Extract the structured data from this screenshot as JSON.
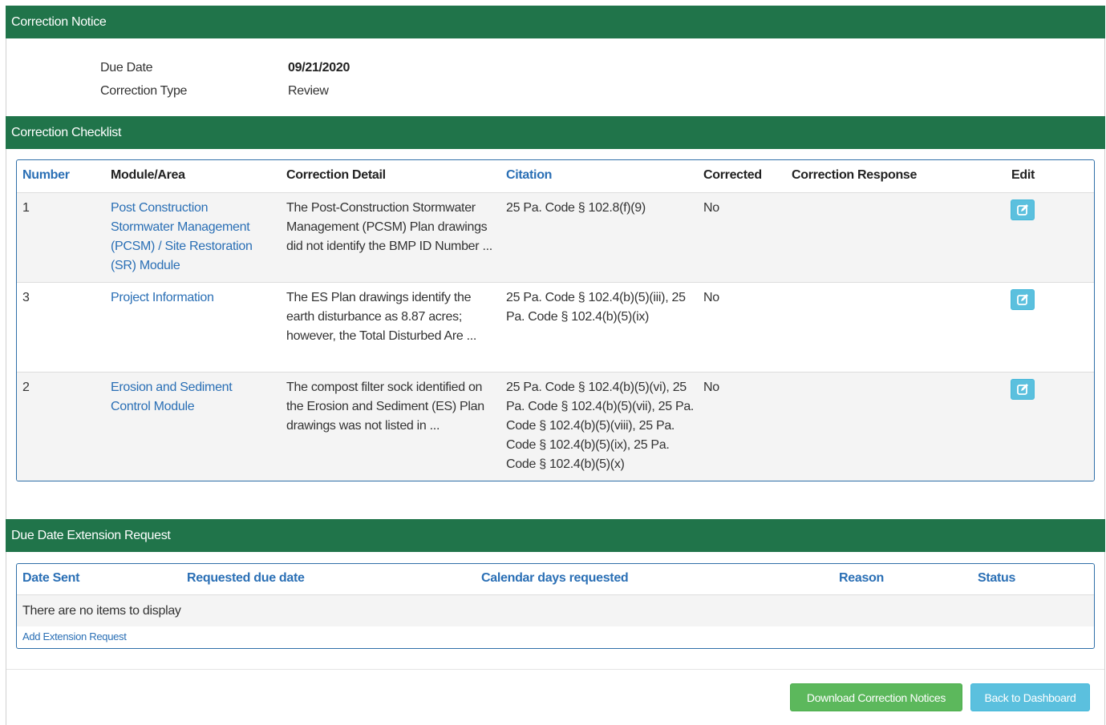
{
  "correction_notice": {
    "header": "Correction Notice",
    "due_date_label": "Due Date",
    "due_date_value": "09/21/2020",
    "correction_type_label": "Correction Type",
    "correction_type_value": "Review"
  },
  "checklist": {
    "header": "Correction Checklist",
    "columns": {
      "number": "Number",
      "module": "Module/Area",
      "detail": "Correction Detail",
      "citation": "Citation",
      "corrected": "Corrected",
      "response": "Correction Response",
      "edit": "Edit"
    },
    "rows": [
      {
        "number": "1",
        "module": "Post Construction Stormwater Management (PCSM) / Site Restoration (SR) Module",
        "detail": "The Post-Construction Stormwater Management (PCSM) Plan drawings did not identify the BMP ID Number ...",
        "citation": "25 Pa. Code § 102.8(f)(9)",
        "corrected": "No",
        "response": ""
      },
      {
        "number": "3",
        "module": "Project Information",
        "detail": "The ES Plan drawings identify the earth disturbance as 8.87 acres; however, the Total Disturbed Are ...",
        "citation": "25 Pa. Code § 102.4(b)(5)(iii), 25 Pa. Code § 102.4(b)(5)(ix)",
        "corrected": "No",
        "response": ""
      },
      {
        "number": "2",
        "module": "Erosion and Sediment Control Module",
        "detail": "The compost filter sock identified on the Erosion and Sediment (ES) Plan drawings was not listed in ...",
        "citation": "25 Pa. Code § 102.4(b)(5)(vi), 25 Pa. Code § 102.4(b)(5)(vii), 25 Pa. Code § 102.4(b)(5)(viii), 25 Pa. Code § 102.4(b)(5)(ix), 25 Pa. Code § 102.4(b)(5)(x)",
        "corrected": "No",
        "response": ""
      }
    ]
  },
  "extension": {
    "header": "Due Date Extension Request",
    "columns": {
      "date_sent": "Date Sent",
      "requested_due_date": "Requested due date",
      "calendar_days": "Calendar days requested",
      "reason": "Reason",
      "status": "Status"
    },
    "empty_message": "There are no items to display",
    "add_link": "Add Extension Request"
  },
  "footer": {
    "download_button": "Download Correction Notices",
    "back_button": "Back to Dashboard"
  },
  "colors": {
    "header_green": "#20744a",
    "link_blue": "#2a6fb5",
    "edit_button": "#5bc0de",
    "download_green": "#5cb85c"
  }
}
